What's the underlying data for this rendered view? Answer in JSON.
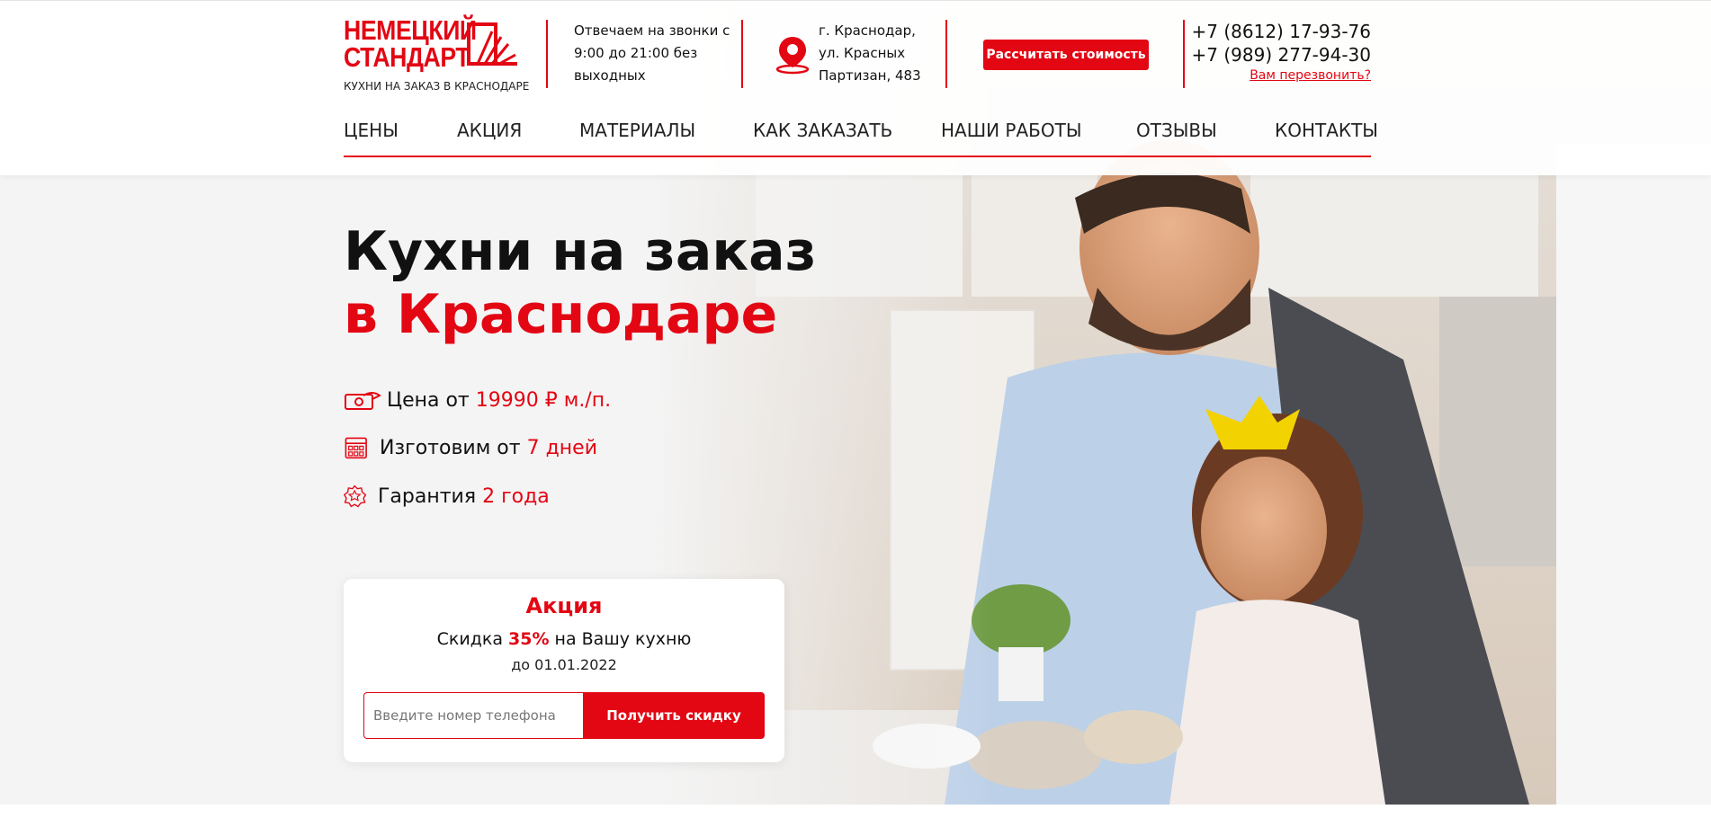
{
  "logo": {
    "line1": "НЕМЕЦКИЙ",
    "line2": "СТАНДАРТ",
    "subtitle": "КУХНИ НА ЗАКАЗ В КРАСНОДАРЕ"
  },
  "header": {
    "hours": "Отвечаем на звонки с 9:00 до 21:00 без выходных",
    "address": [
      "г. Краснодар,",
      "ул. Красных",
      "Партизан, 483"
    ],
    "calc_button": "Рассчитать стоимость",
    "phones": [
      "+7 (8612) 17-93-76",
      "+7 (989) 277-94-30"
    ],
    "callback_link": "Вам перезвонить?"
  },
  "nav": [
    "ЦЕНЫ",
    "АКЦИЯ",
    "МАТЕРИАЛЫ",
    "КАК ЗАКАЗАТЬ",
    "НАШИ РАБОТЫ",
    "ОТЗЫВЫ",
    "КОНТАКТЫ"
  ],
  "hero": {
    "title_line1": "Кухни на заказ",
    "title_line2": "в Краснодаре",
    "features": [
      {
        "icon": "money-hand-icon",
        "text": "Цена от ",
        "highlight": "19990 ₽ м./п."
      },
      {
        "icon": "calendar-icon",
        "text": "Изготовим от ",
        "highlight": "7 дней"
      },
      {
        "icon": "award-badge-icon",
        "text": "Гарантия ",
        "highlight": "2 года"
      }
    ]
  },
  "promo": {
    "title": "Акция",
    "text_before": "Скидка ",
    "percent": "35%",
    "text_after": " на Вашу кухню",
    "date": "до 01.01.2022",
    "input_placeholder": "Введите номер телефона",
    "button": "Получить скидку"
  },
  "colors": {
    "accent": "#e30613",
    "text": "#111111",
    "background": "#f4f4f4"
  }
}
